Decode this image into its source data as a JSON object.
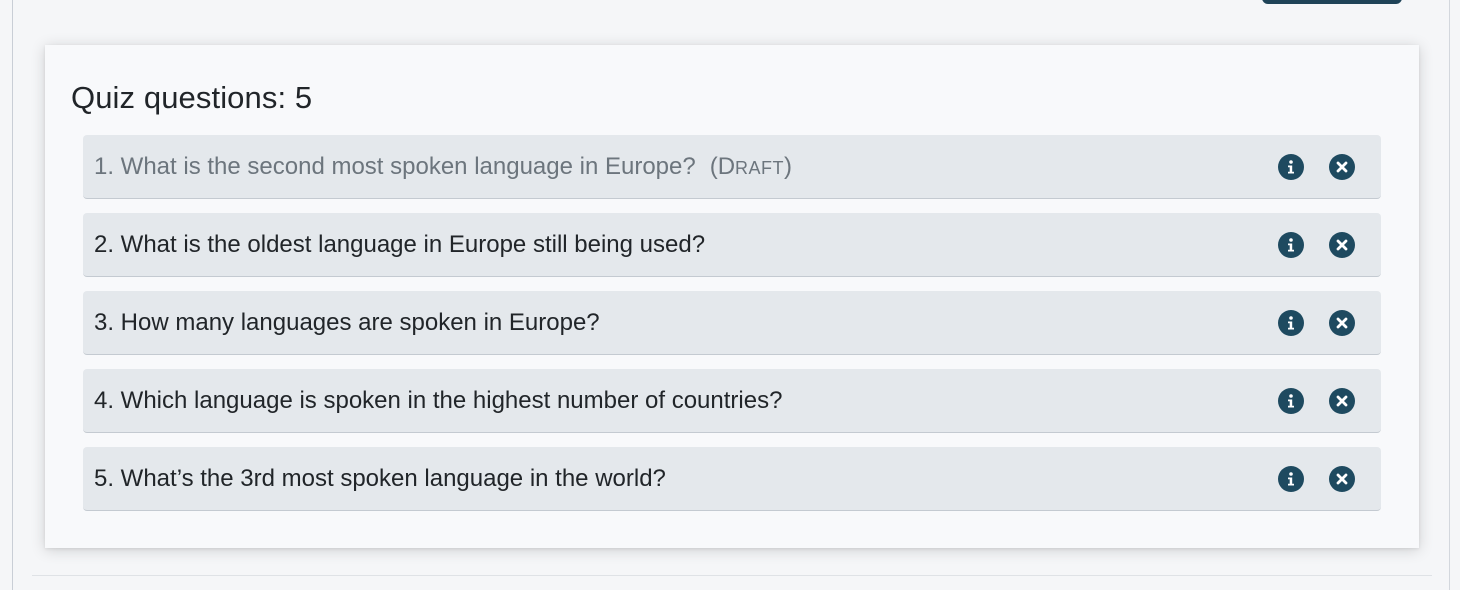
{
  "quiz": {
    "title": "Quiz questions: 5",
    "questions": [
      {
        "text": "1. What is the second most spoken language in Europe?",
        "draft": true,
        "draft_label_open": "(D",
        "draft_label_caps": "RAFT",
        "draft_label_close": ")"
      },
      {
        "text": "2. What is the oldest language in Europe still being used?",
        "draft": false
      },
      {
        "text": "3. How many languages are spoken in Europe?",
        "draft": false
      },
      {
        "text": "4. Which language is spoken in the highest number of countries?",
        "draft": false
      },
      {
        "text": "5. What’s the 3rd most spoken language in the world?",
        "draft": false
      }
    ]
  },
  "icons": {
    "info": "info-circle-icon",
    "remove": "times-circle-icon"
  },
  "colors": {
    "icon": "#1e4a60",
    "row_background": "#e4e8ec",
    "draft_text": "#6c757d"
  }
}
